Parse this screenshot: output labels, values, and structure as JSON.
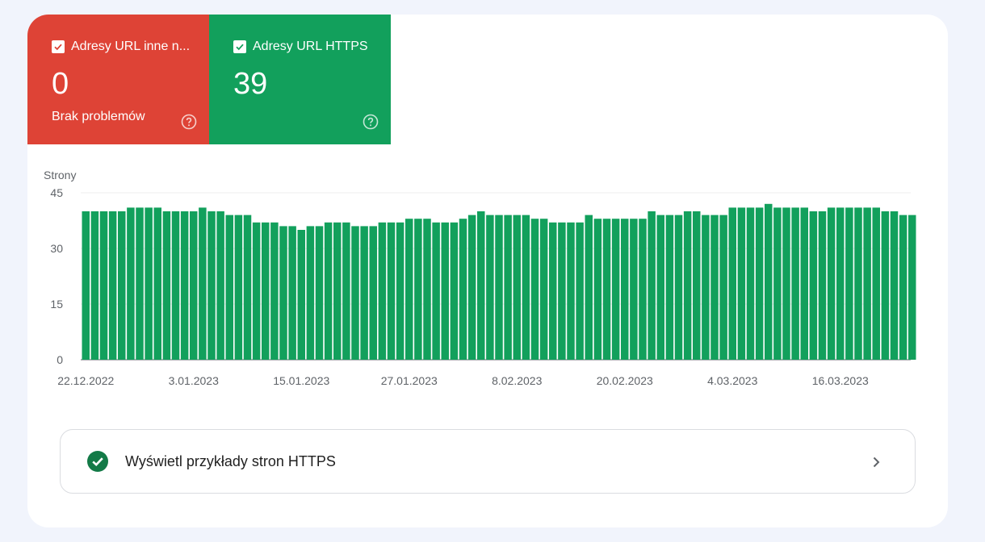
{
  "tiles": [
    {
      "label": "Adresy URL inne n...",
      "value": "0",
      "sub": "Brak problemów",
      "color": "#de4336",
      "checked": true,
      "icon": "check-icon"
    },
    {
      "label": "Adresy URL HTTPS",
      "value": "39",
      "sub": "",
      "color": "#12a05c",
      "checked": true,
      "icon": "check-icon"
    }
  ],
  "examples": {
    "label": "Wyświetl przykłady stron HTTPS",
    "icon": "check-circle-icon",
    "chevron": "chevron-right-icon"
  },
  "chart_data": {
    "type": "bar",
    "ylabel": "Strony",
    "ylim": [
      0,
      45
    ],
    "yticks": [
      0,
      15,
      30,
      45
    ],
    "xticks": [
      "22.12.2022",
      "3.01.2023",
      "15.01.2023",
      "27.01.2023",
      "8.02.2023",
      "20.02.2023",
      "4.03.2023",
      "16.03.2023"
    ],
    "bar_color": "#12a05c",
    "grid": true,
    "start_date": "2022-12-22",
    "values": [
      40,
      40,
      40,
      40,
      40,
      41,
      41,
      41,
      41,
      40,
      40,
      40,
      40,
      41,
      40,
      40,
      39,
      39,
      39,
      37,
      37,
      37,
      36,
      36,
      35,
      36,
      36,
      37,
      37,
      37,
      36,
      36,
      36,
      37,
      37,
      37,
      38,
      38,
      38,
      37,
      37,
      37,
      38,
      39,
      40,
      39,
      39,
      39,
      39,
      39,
      38,
      38,
      37,
      37,
      37,
      37,
      39,
      38,
      38,
      38,
      38,
      38,
      38,
      40,
      39,
      39,
      39,
      40,
      40,
      39,
      39,
      39,
      41,
      41,
      41,
      41,
      42,
      41,
      41,
      41,
      41,
      40,
      40,
      41,
      41,
      41,
      41,
      41,
      41,
      40,
      40,
      39,
      39
    ]
  }
}
